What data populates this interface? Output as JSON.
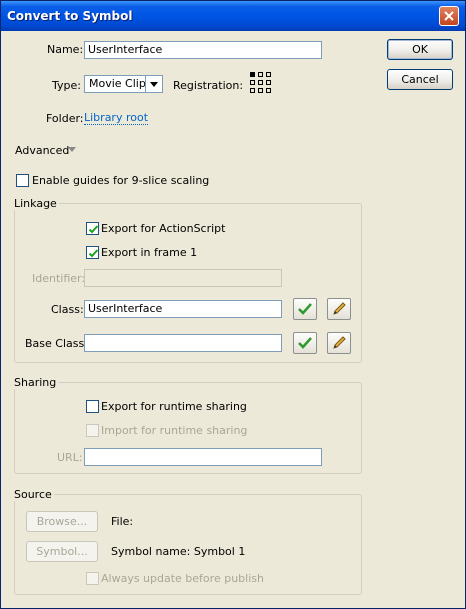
{
  "window": {
    "title": "Convert to Symbol"
  },
  "form": {
    "name_label": "Name:",
    "name_value": "UserInterface",
    "type_label": "Type:",
    "type_value": "Movie Clip",
    "registration_label": "Registration:",
    "folder_label": "Folder:",
    "folder_link": "Library root",
    "advanced_label": "Advanced",
    "nine_slice_label": "Enable guides for 9-slice scaling"
  },
  "buttons": {
    "ok": "OK",
    "cancel": "Cancel"
  },
  "linkage": {
    "title": "Linkage",
    "export_actionscript": "Export for ActionScript",
    "export_frame1": "Export in frame 1",
    "identifier_label": "Identifier:",
    "identifier_value": "",
    "class_label": "Class:",
    "class_value": "UserInterface",
    "base_class_label": "Base Class:",
    "base_class_value": ""
  },
  "sharing": {
    "title": "Sharing",
    "export_runtime": "Export for runtime sharing",
    "import_runtime": "Import for runtime sharing",
    "url_label": "URL:",
    "url_value": ""
  },
  "source": {
    "title": "Source",
    "browse_button": "Browse...",
    "file_label": "File:",
    "symbol_button": "Symbol...",
    "symbol_name_label": "Symbol name: Symbol 1",
    "always_update": "Always update before publish"
  },
  "checkbox_states": {
    "nine_slice": false,
    "export_actionscript": true,
    "export_frame1": true,
    "export_runtime": false,
    "import_runtime": false,
    "always_update": false
  },
  "colors": {
    "title_bar": "#0055e5",
    "dialog_bg": "#ece9d8",
    "link": "#0066cc",
    "check_green": "#2e9a2e"
  }
}
